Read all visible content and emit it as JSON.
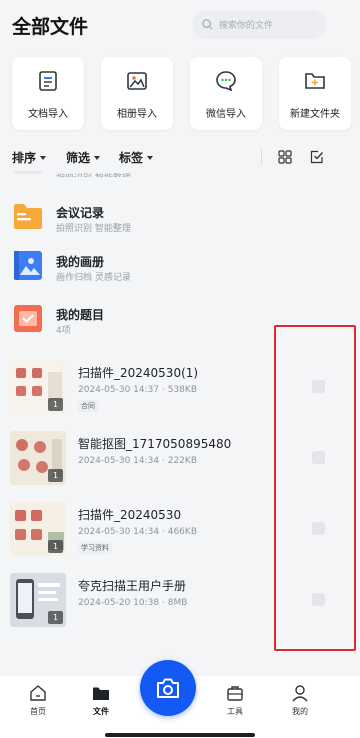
{
  "header": {
    "title": "全部文件",
    "search_placeholder": "搜索你的文件"
  },
  "quick_actions": [
    {
      "label": "文档导入",
      "icon": "document-import-icon"
    },
    {
      "label": "相册导入",
      "icon": "album-import-icon"
    },
    {
      "label": "微信导入",
      "icon": "wechat-import-icon"
    },
    {
      "label": "新建文件夹",
      "icon": "new-folder-icon"
    }
  ],
  "toolbar": {
    "sort": "排序",
    "filter": "筛选",
    "tags": "标签"
  },
  "partial_row_sub": "相册识别  智能整理",
  "folders": [
    {
      "title": "会议记录",
      "subtitle": "拍照识别  智能整理",
      "color": "#f6a93b"
    },
    {
      "title": "我的画册",
      "subtitle": "画作归档  灵感记录",
      "color": "#3d7df3"
    },
    {
      "title": "我的题目",
      "subtitle": "4项",
      "color": "#f26c4f"
    }
  ],
  "files": [
    {
      "title": "扫描件_20240530(1)",
      "date": "2024-05-30 14:37",
      "size": "538KB",
      "tag": "合同",
      "pages": "1"
    },
    {
      "title": "智能抠图_1717050895480",
      "date": "2024-05-30 14:34",
      "size": "222KB",
      "tag": "",
      "pages": "1"
    },
    {
      "title": "扫描件_20240530",
      "date": "2024-05-30 14:34",
      "size": "466KB",
      "tag": "学习资料",
      "pages": "1"
    },
    {
      "title": "夸克扫描王用户手册",
      "date": "2024-05-20 10:38",
      "size": "8MB",
      "tag": "",
      "pages": "1"
    }
  ],
  "meta_sep": "·",
  "tabbar": {
    "home": "首页",
    "files": "文件",
    "tools": "工具",
    "mine": "我的"
  },
  "colors": {
    "accent": "#1559f5",
    "highlight": "#e0282e",
    "background": "#f4f5f7"
  }
}
